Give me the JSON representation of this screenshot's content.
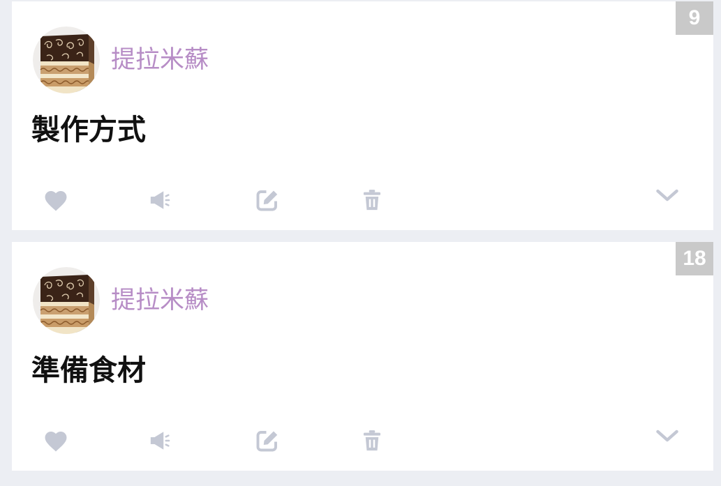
{
  "colors": {
    "page_background": "#eceef3",
    "card_background": "#ffffff",
    "author": "#b78dc6",
    "title": "#111111",
    "icon": "#c4c8d4",
    "badge_background": "#c9c9c9",
    "badge_text": "#ffffff"
  },
  "posts": [
    {
      "badge": "9",
      "author": "提拉米蘇",
      "title": "製作方式",
      "actions": {
        "like_icon": "heart-icon",
        "announce_icon": "megaphone-icon",
        "edit_icon": "edit-icon",
        "delete_icon": "trash-icon",
        "expand_icon": "chevron-down-icon"
      }
    },
    {
      "badge": "18",
      "author": "提拉米蘇",
      "title": "準備食材",
      "actions": {
        "like_icon": "heart-icon",
        "announce_icon": "megaphone-icon",
        "edit_icon": "edit-icon",
        "delete_icon": "trash-icon",
        "expand_icon": "chevron-down-icon"
      }
    }
  ]
}
